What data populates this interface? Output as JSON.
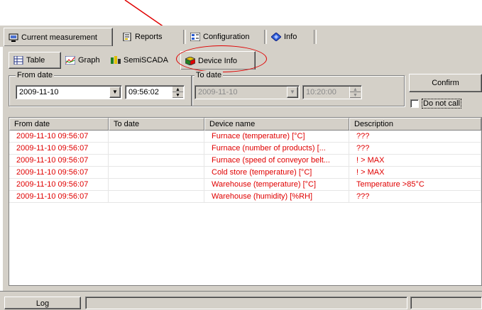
{
  "top_tabs": [
    {
      "label": "Current measurement",
      "icon": "monitor-icon"
    },
    {
      "label": "Reports",
      "icon": "report-icon"
    },
    {
      "label": "Configuration",
      "icon": "configuration-icon"
    },
    {
      "label": "Info",
      "icon": "info-diamond-icon"
    }
  ],
  "sub_tabs": [
    {
      "label": "Table",
      "icon": "table-icon"
    },
    {
      "label": "Graph",
      "icon": "graph-icon"
    },
    {
      "label": "SemiSCADA",
      "icon": "scada-icon"
    },
    {
      "label": "Device Info",
      "icon": "device-info-icon",
      "active": true
    }
  ],
  "filter": {
    "from_label": "From date",
    "from_date": "2009-11-10",
    "from_time": "09:56:02",
    "to_label": "To date",
    "to_date": "2009-11-10",
    "to_time": "10:20:00",
    "confirm_label": "Confirm",
    "do_not_call_label": "Do not call",
    "do_not_call_checked": false
  },
  "table": {
    "columns": [
      "From date",
      "To date",
      "Device name",
      "Description"
    ],
    "rows": [
      [
        "2009-11-10 09:56:07",
        "",
        "Furnace (temperature)  [°C]",
        "???"
      ],
      [
        "2009-11-10 09:56:07",
        "",
        "Furnace (number of products)  [...",
        "???"
      ],
      [
        "2009-11-10 09:56:07",
        "",
        "Furnace (speed of conveyor belt...",
        "! > MAX"
      ],
      [
        "2009-11-10 09:56:07",
        "",
        "Cold store (temperature)  [°C]",
        "! > MAX"
      ],
      [
        "2009-11-10 09:56:07",
        "",
        "Warehouse (temperature)  [°C]",
        "Temperature >85°C"
      ],
      [
        "2009-11-10 09:56:07",
        "",
        "Warehouse (humidity)  [%RH]",
        "???"
      ]
    ],
    "row_color": "#e00000"
  },
  "bottom": {
    "log_label": "Log"
  },
  "annotation_color": "#e00000"
}
